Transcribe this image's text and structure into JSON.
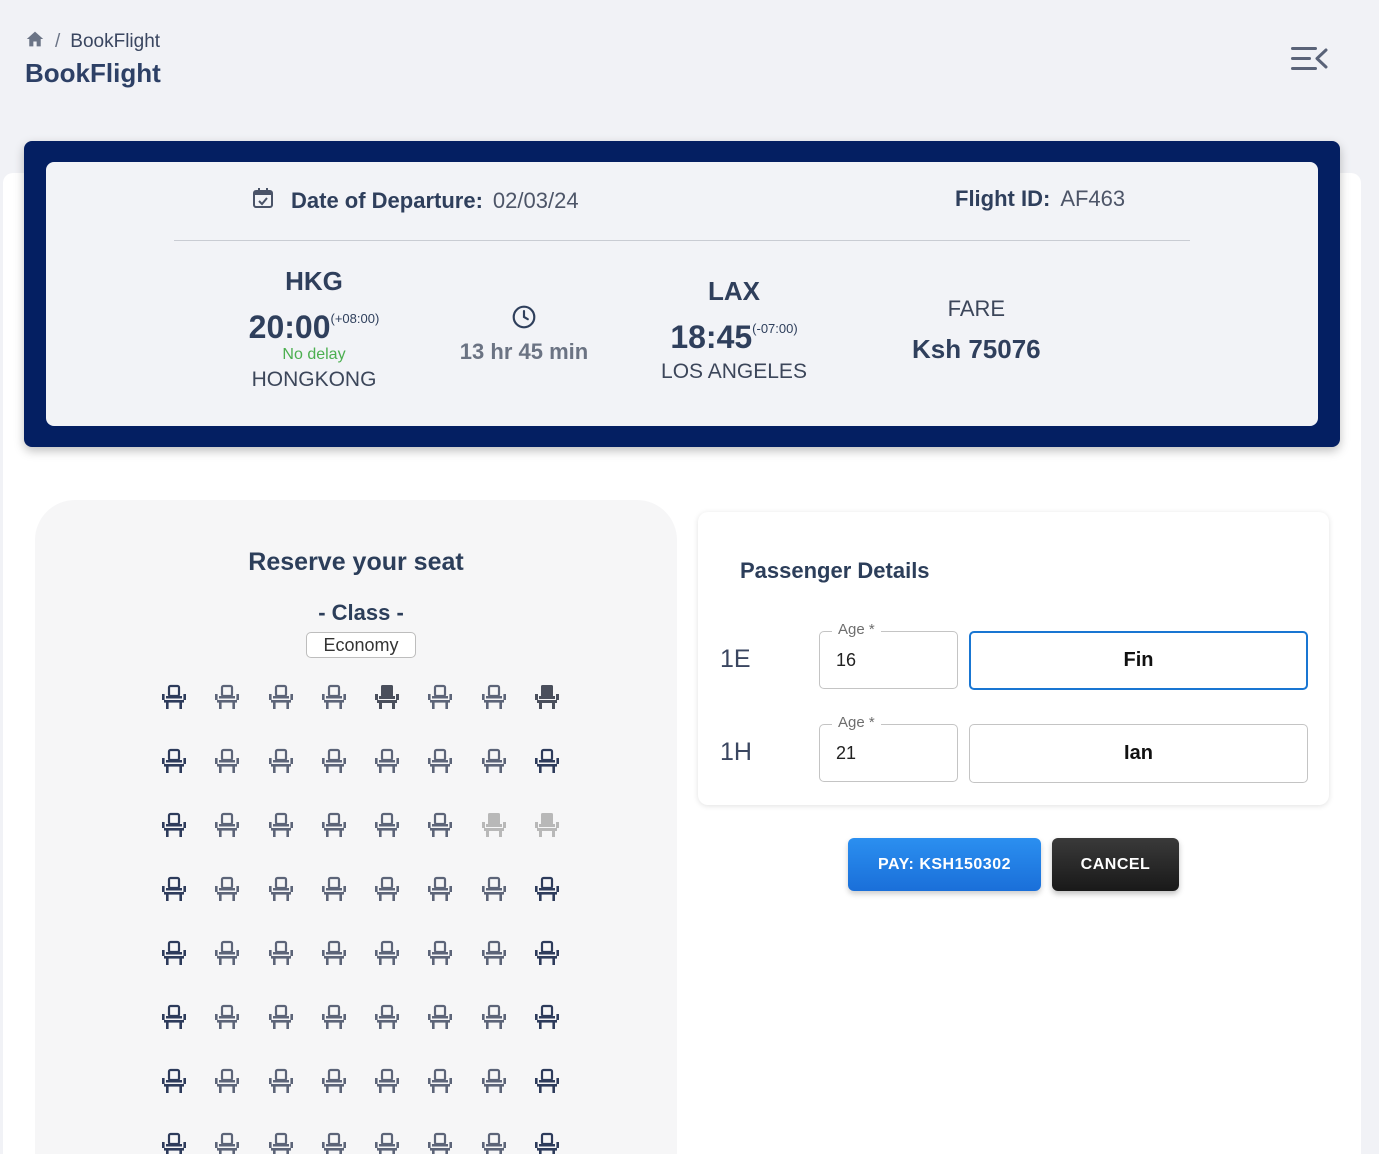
{
  "breadcrumb": {
    "home_icon": "home-icon",
    "separator": "/",
    "current": "BookFlight"
  },
  "page": {
    "title": "BookFlight",
    "menu_icon": "menu-collapse-icon"
  },
  "flight": {
    "departure_label": "Date of Departure:",
    "departure_date": "02/03/24",
    "flight_id_label": "Flight ID:",
    "flight_id": "AF463",
    "origin": {
      "code": "HKG",
      "time": "20:00",
      "tz": "(+08:00)",
      "status": "No delay",
      "city": "HONGKONG"
    },
    "duration": "13 hr 45 min",
    "destination": {
      "code": "LAX",
      "time": "18:45",
      "tz": "(-07:00)",
      "city": "LOS ANGELES"
    },
    "fare_label": "FARE",
    "fare_value": "Ksh 75076"
  },
  "seat_map": {
    "title": "Reserve your seat",
    "class_label": "- Class -",
    "class_value": "Economy",
    "rows": [
      [
        "dark",
        "light",
        "light",
        "light",
        "selected",
        "light",
        "light",
        "selected"
      ],
      [
        "dark",
        "light",
        "light",
        "light",
        "light",
        "light",
        "light",
        "dark"
      ],
      [
        "dark",
        "light",
        "light",
        "light",
        "light",
        "light",
        "booked",
        "booked"
      ],
      [
        "dark",
        "light",
        "light",
        "light",
        "light",
        "light",
        "light",
        "dark"
      ],
      [
        "dark",
        "light",
        "light",
        "light",
        "light",
        "light",
        "light",
        "dark"
      ],
      [
        "dark",
        "light",
        "light",
        "light",
        "light",
        "light",
        "light",
        "dark"
      ],
      [
        "dark",
        "light",
        "light",
        "light",
        "light",
        "light",
        "light",
        "dark"
      ],
      [
        "dark",
        "light",
        "light",
        "light",
        "light",
        "light",
        "light",
        "dark"
      ]
    ]
  },
  "passengers": {
    "title": "Passenger Details",
    "age_label": "Age *",
    "list": [
      {
        "seat": "1E",
        "age": "16",
        "name": "Fin"
      },
      {
        "seat": "1H",
        "age": "21",
        "name": "Ian"
      }
    ]
  },
  "actions": {
    "pay_label": "PAY: KSH150302",
    "cancel_label": "CANCEL"
  },
  "colors": {
    "banner": "#041f62",
    "primary": "#1976d2",
    "seat_dark": "#2d3b5b",
    "seat_light": "#5c6478",
    "seat_booked": "#b8b8b8",
    "delay_ok": "#4caf50"
  }
}
